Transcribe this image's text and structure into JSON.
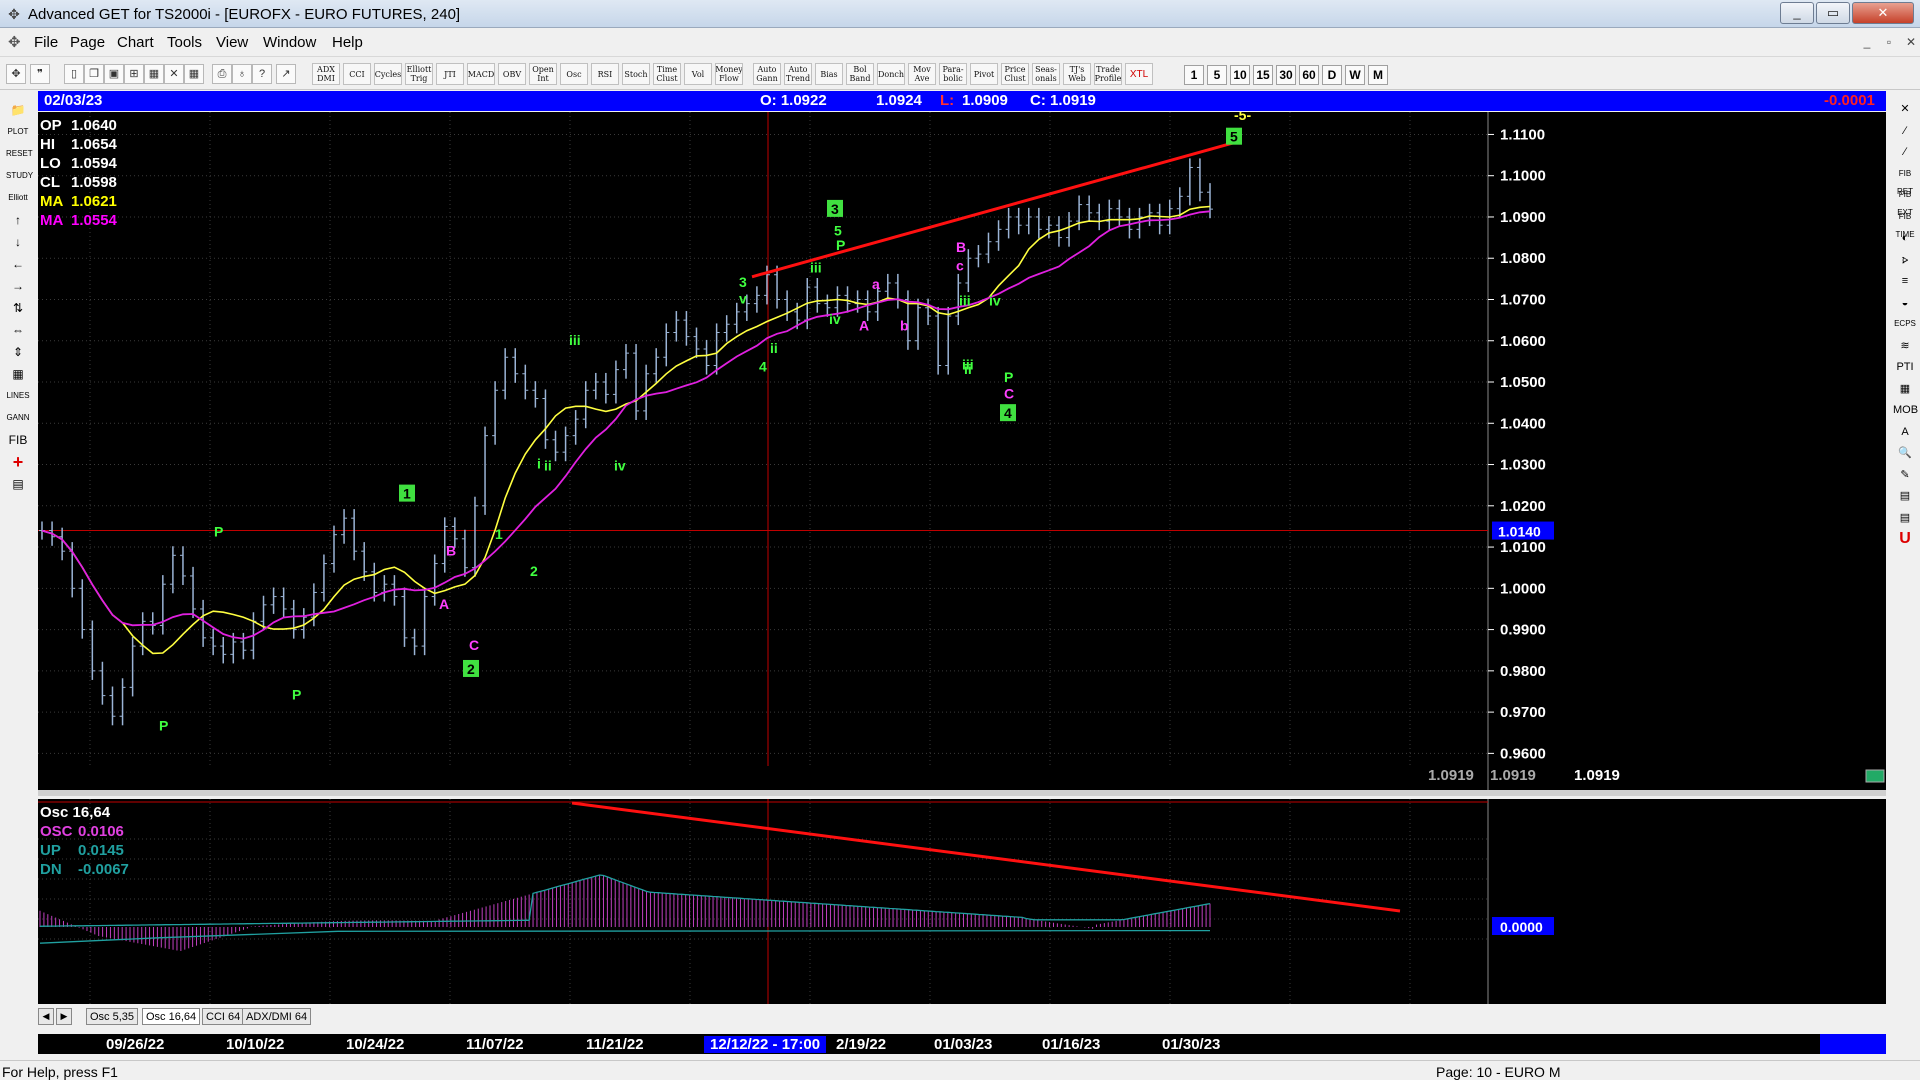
{
  "window": {
    "title": "Advanced GET for TS2000i - [EUROFX - EURO FUTURES, 240]",
    "controls": [
      "_",
      "▭",
      "✕"
    ]
  },
  "menu": {
    "items": [
      "File",
      "Page",
      "Chart",
      "Tools",
      "View",
      "Window",
      "Help"
    ]
  },
  "toolbar": {
    "indicators": [
      "ADX DMI",
      "CCI",
      "Cycles",
      "Elliott Trig",
      "JTI",
      "MACD",
      "OBV",
      "Open Int",
      "Osc",
      "RSI",
      "Stoch",
      "Time Clust",
      "Vol",
      "Money Flow",
      "Auto Gann",
      "Auto Trend",
      "Bias",
      "Bol Band",
      "Donch",
      "Mov Ave",
      "Para-bolic",
      "Pivot",
      "Price Clust",
      "Seas-onals",
      "TJ's Web",
      "Trade Profile",
      "XTL"
    ],
    "timeframes": [
      "1",
      "5",
      "10",
      "15",
      "30",
      "60",
      "D",
      "W",
      "M"
    ]
  },
  "left_tools": [
    "📁",
    "PLOT",
    "RESET",
    "STUDY",
    "Elliott",
    "↑",
    "↓",
    "←",
    "→",
    "⇅",
    "⇔",
    "⇕",
    "▦",
    "LINES",
    "GANN",
    "FIB",
    "+",
    "▤"
  ],
  "right_tools": [
    "✕",
    "∕",
    "∕",
    "FIB RET",
    "FIB EXT",
    "FIB TIME",
    "◐",
    "⦠",
    "≡",
    "◒",
    "ECPS",
    "≋",
    "PTI",
    "▦",
    "MOB",
    "A",
    "🔍",
    "✎",
    "▤",
    "▤",
    "U"
  ],
  "infobar": {
    "date": "02/03/23",
    "open": "O: 1.0922",
    "high": "1.0924",
    "low_label": "L:",
    "low": "1.0909",
    "close": "C: 1.0919",
    "change": "-0.0001"
  },
  "legend": [
    {
      "label": "OP",
      "value": "1.0640",
      "color": "#ffffff"
    },
    {
      "label": "HI",
      "value": "1.0654",
      "color": "#ffffff"
    },
    {
      "label": "LO",
      "value": "1.0594",
      "color": "#ffffff"
    },
    {
      "label": "CL",
      "value": "1.0598",
      "color": "#ffffff"
    },
    {
      "label": "MA",
      "value": "1.0621",
      "color": "#ffff00"
    },
    {
      "label": "MA",
      "value": "1.0554",
      "color": "#ff00ff"
    }
  ],
  "price_axis": {
    "ticks": [
      "1.1100",
      "1.1000",
      "1.0900",
      "1.0800",
      "1.0700",
      "1.0600",
      "1.0500",
      "1.0400",
      "1.0300",
      "1.0200",
      "1.0100",
      "1.0000",
      "0.9900",
      "0.9800",
      "0.9700",
      "0.9600"
    ],
    "marker": "1.0140",
    "readouts": [
      "1.0919",
      "1.0919",
      "1.0919"
    ]
  },
  "osc_panel": {
    "title": "Osc 16,64",
    "lines": [
      {
        "label": "OSC",
        "value": "0.0106",
        "color": "#e040e0"
      },
      {
        "label": "UP",
        "value": "0.0145",
        "color": "#20a0a0"
      },
      {
        "label": "DN",
        "value": "-0.0067",
        "color": "#20a0a0"
      }
    ],
    "zero_label": "0.0000"
  },
  "tabs": [
    "Osc 5,35",
    "Osc 16,64",
    "CCI 64",
    "ADX/DMI 64"
  ],
  "dates": [
    "09/26/22",
    "10/10/22",
    "10/24/22",
    "11/07/22",
    "11/21/22",
    "12/12/22 - 17:00",
    "2/19/22",
    "01/03/23",
    "01/16/23",
    "01/30/23"
  ],
  "status": {
    "help": "For Help, press F1",
    "page": "Page: 10 - EURO M"
  },
  "chart_data": {
    "type": "line",
    "instrument": "EUROFX - EURO FUTURES, 240",
    "ylim": [
      0.955,
      1.1135
    ],
    "price_series_close": [
      1.014,
      1.0125,
      1.009,
      1.0,
      0.99,
      0.98,
      0.974,
      0.969,
      0.976,
      0.986,
      0.992,
      0.991,
      1.001,
      1.008,
      1.003,
      0.995,
      0.988,
      0.986,
      0.984,
      0.987,
      0.985,
      0.992,
      0.996,
      0.998,
      0.995,
      0.99,
      0.993,
      0.999,
      1.006,
      1.013,
      1.017,
      1.009,
      1.004,
      0.999,
      1.001,
      0.998,
      0.988,
      0.986,
      0.998,
      1.006,
      1.015,
      1.012,
      1.005,
      1.02,
      1.037,
      1.048,
      1.056,
      1.052,
      1.048,
      1.046,
      1.036,
      1.033,
      1.037,
      1.041,
      1.048,
      1.05,
      1.047,
      1.053,
      1.057,
      1.043,
      1.052,
      1.056,
      1.062,
      1.065,
      1.061,
      1.058,
      1.054,
      1.062,
      1.064,
      1.067,
      1.069,
      1.071,
      1.076,
      1.07,
      1.067,
      1.065,
      1.073,
      1.069,
      1.068,
      1.071,
      1.069,
      1.07,
      1.067,
      1.072,
      1.074,
      1.07,
      1.06,
      1.068,
      1.066,
      1.054,
      1.066,
      1.074,
      1.08,
      1.081,
      1.084,
      1.087,
      1.09,
      1.088,
      1.09,
      1.087,
      1.088,
      1.085,
      1.089,
      1.093,
      1.091,
      1.089,
      1.092,
      1.09,
      1.087,
      1.09,
      1.091,
      1.088,
      1.092,
      1.095,
      1.102,
      1.096,
      1.0919
    ],
    "ma_yellow": "short moving average (MA 1.0621)",
    "ma_magenta": "long moving average (MA 1.0554)",
    "trendline_upper": {
      "start": [
        0.8,
        1.0755
      ],
      "end": [
        1.0,
        1.108
      ]
    },
    "wave_labels": [
      "P",
      "P",
      "P",
      "P",
      "1",
      "A",
      "B",
      "C",
      "2",
      "1",
      "2",
      "i",
      "ii",
      "iii",
      "iv",
      "3",
      "v",
      "4",
      "iii",
      "ii",
      "3",
      "5",
      "P",
      "iv",
      "a",
      "A",
      "b",
      "B",
      "c",
      "iii",
      "ii",
      "iv",
      "iii",
      "P",
      "C",
      "4",
      "5",
      "-5-"
    ],
    "oscillator": {
      "name": "Osc 16,64",
      "peak": 0.0145,
      "trough": -0.0067,
      "trendline": "declining from late-Nov peak to Feb"
    }
  }
}
